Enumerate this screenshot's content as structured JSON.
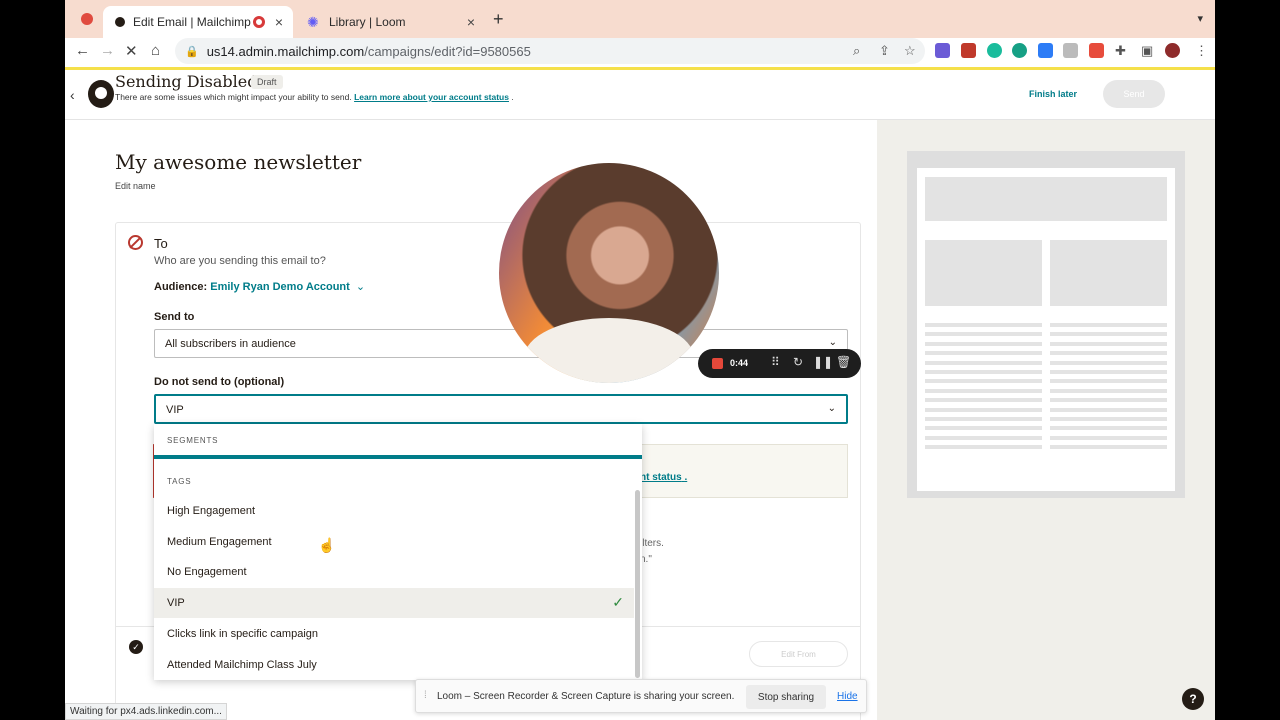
{
  "browser": {
    "tabs": [
      {
        "title": "Edit Email | Mailchimp",
        "active": true
      },
      {
        "title": "Library | Loom",
        "active": false
      }
    ],
    "url_host": "us14.admin.mailchimp.com",
    "url_path": "/campaigns/edit?id=9580565",
    "status_text": "Waiting for px4.ads.linkedin.com..."
  },
  "header": {
    "title": "Sending Disabled",
    "badge": "Draft",
    "subtitle": "There are some issues which might impact your ability to send.",
    "subtitle_link": "Learn more about your account status",
    "finish_later": "Finish later",
    "send": "Send"
  },
  "campaign": {
    "name": "My awesome newsletter",
    "edit_name": "Edit name"
  },
  "to_section": {
    "heading": "To",
    "question": "Who are you sending this email to?",
    "audience_label": "Audience:",
    "audience_name": "Emily Ryan Demo Account",
    "send_to_label": "Send to",
    "send_to_value": "All subscribers in audience",
    "do_not_send_label": "Do not send to (optional)",
    "do_not_send_value": "VIP",
    "alert_link_fragment": "nt status",
    "filters_fragment_1": "ilters.",
    "filters_fragment_2": "n.\""
  },
  "dropdown": {
    "segments_header": "SEGMENTS",
    "tags_header": "TAGS",
    "items": [
      {
        "label": "High Engagement",
        "selected": false
      },
      {
        "label": "Medium Engagement",
        "selected": false
      },
      {
        "label": "No Engagement",
        "selected": false
      },
      {
        "label": "VIP",
        "selected": true
      },
      {
        "label": "Clicks link in specific campaign",
        "selected": false
      },
      {
        "label": "Attended Mailchimp Class July",
        "selected": false
      }
    ]
  },
  "from_section": {
    "edit_from": "Edit From"
  },
  "loom": {
    "timer": "0:44",
    "share_text": "Loom – Screen Recorder & Screen Capture is sharing your screen.",
    "stop_sharing": "Stop sharing",
    "hide": "Hide"
  },
  "help": "?",
  "colors": {
    "teal": "#007c89",
    "error": "#b9382f",
    "ink": "#241c15"
  }
}
